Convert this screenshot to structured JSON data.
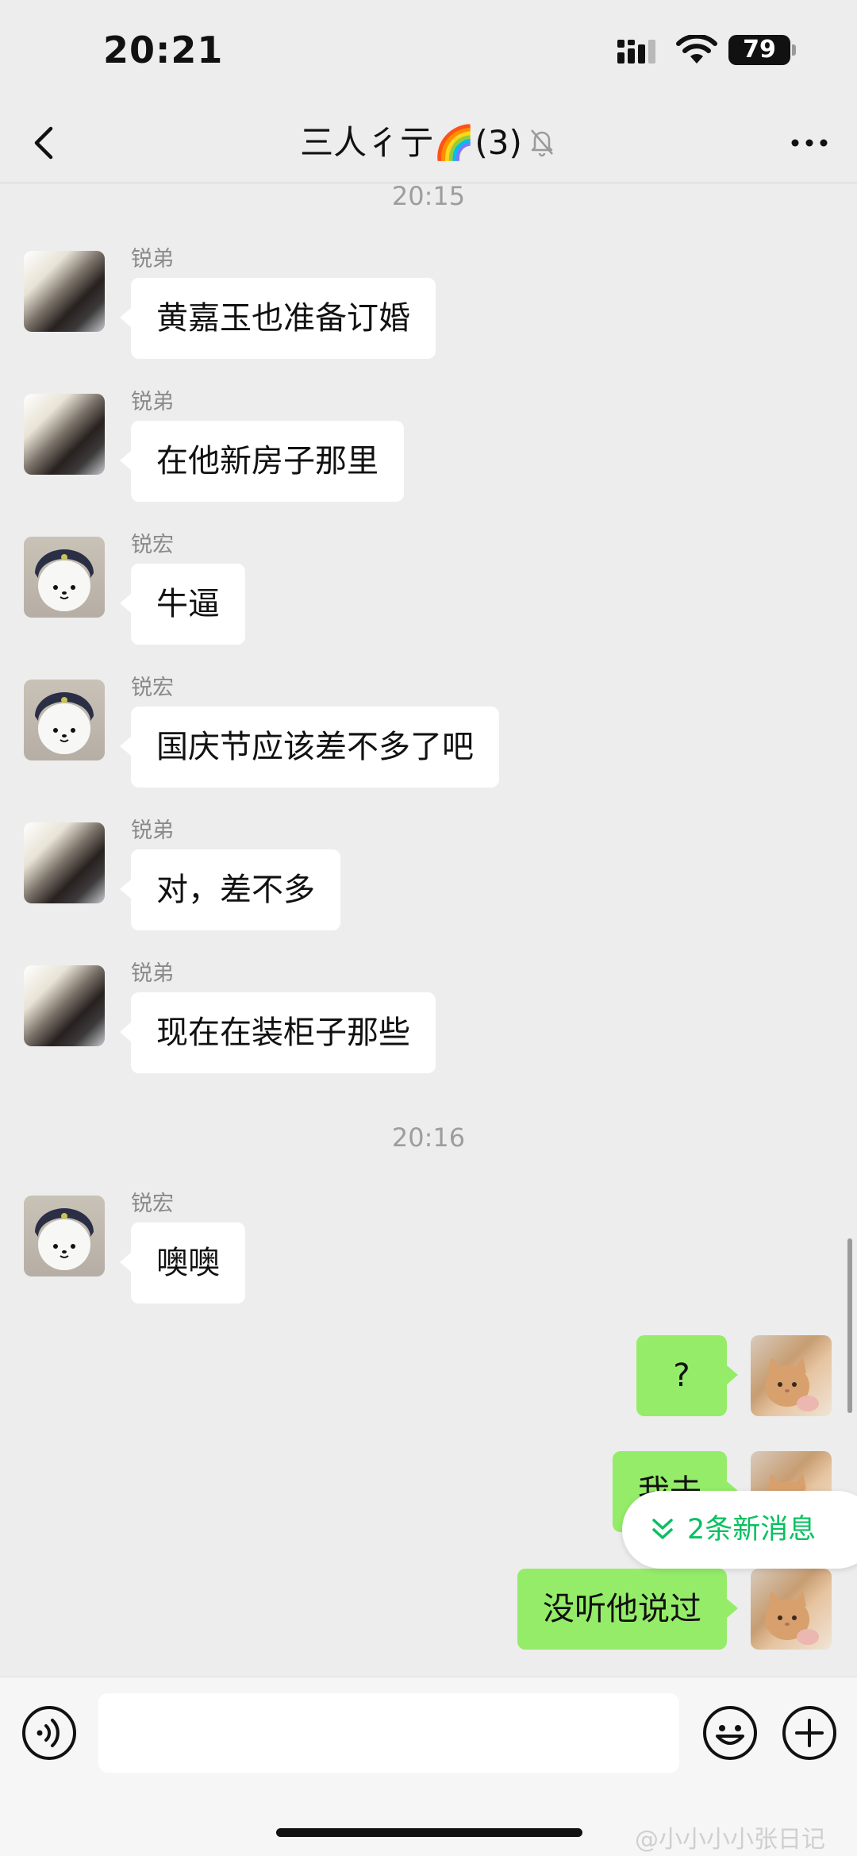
{
  "status": {
    "time": "20:21",
    "battery": "79"
  },
  "nav": {
    "title": "三人彳亍🌈(3)"
  },
  "messages": {
    "ts1": "20:15",
    "m1": {
      "sender": "锐弟",
      "text": "黄嘉玉也准备订婚"
    },
    "m2": {
      "sender": "锐弟",
      "text": "在他新房子那里"
    },
    "m3": {
      "sender": "锐宏",
      "text": "牛逼"
    },
    "m4": {
      "sender": "锐宏",
      "text": "国庆节应该差不多了吧"
    },
    "m5": {
      "sender": "锐弟",
      "text": "对，差不多"
    },
    "m6": {
      "sender": "锐弟",
      "text": "现在在装柜子那些"
    },
    "ts2": "20:16",
    "m7": {
      "sender": "锐宏",
      "text": "噢噢"
    },
    "m8": {
      "text": "?"
    },
    "m9": {
      "text": "我去"
    },
    "m10": {
      "text": "没听他说过"
    }
  },
  "new_messages": {
    "label": "2条新消息"
  },
  "watermark": "@小小小小张日记",
  "icons": {
    "back": "chevron-left-icon",
    "mute": "bell-off-icon",
    "more": "more-dots-icon",
    "voice": "voice-icon",
    "emoji": "emoji-icon",
    "plus": "plus-icon"
  },
  "colors": {
    "accent": "#07c160",
    "outgoing_bubble": "#95ec69",
    "background": "#ededed"
  }
}
